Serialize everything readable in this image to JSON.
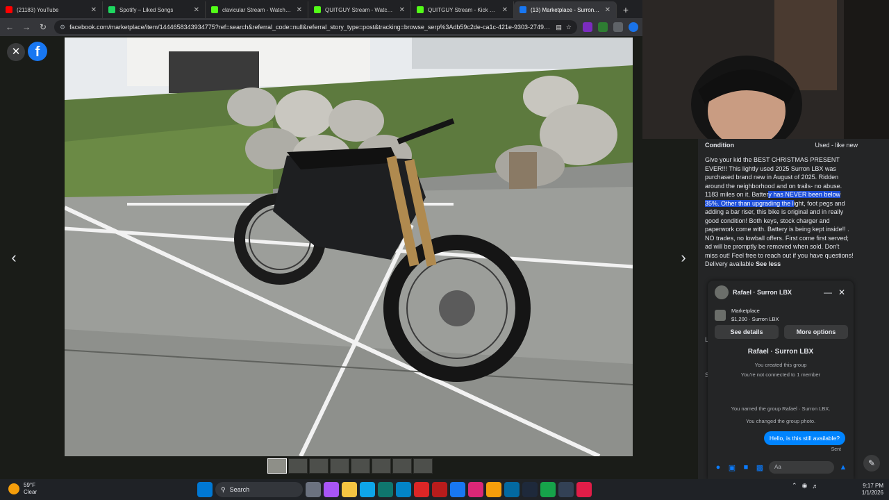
{
  "browser": {
    "tabs": [
      {
        "title": "(21183) YouTube",
        "color": "#ff0000",
        "active": false
      },
      {
        "title": "Spotify – Liked Songs",
        "color": "#1ed760",
        "active": false
      },
      {
        "title": "clavicular Stream - Watch Live o",
        "color": "#53fc18",
        "active": false
      },
      {
        "title": "QUITGUY Stream - Watch Live o",
        "color": "#53fc18",
        "active": false
      },
      {
        "title": "QUITGUY Stream - Kick Dashbo",
        "color": "#53fc18",
        "active": false
      },
      {
        "title": "(13) Marketplace - Surron LBX",
        "color": "#1877f2",
        "active": true
      }
    ],
    "url": "facebook.com/marketplace/item/1444658343934775?ref=search&referral_code=null&referral_story_type=post&tracking=browse_serp%3Adb59c2de-ca1c-421e-9303-274969d..."
  },
  "listing": {
    "condition_label": "Condition",
    "condition_value": "Used - like new",
    "description_before": "Give your kid the BEST CHRISTMAS PRESENT EVER!!! This lightly used 2025 Surron LBX was purchased brand new in August of 2025. Ridden around the neighborhood and on trails- no abuse. 1183 miles on it. Batter",
    "description_highlight": "y has NEVER been below 35%. Other than upgrading the l",
    "description_after": "ight, foot pegs and adding a bar riser, this bike is original and in really good condition! Both keys, stock charger and paperwork come with. Battery is being kept inside!! . NO trades, no lowball offers. First come first served; ad will be promptly be removed when sold. Don't miss out! Feel free to reach out if you have questions!",
    "delivery": "Delivery available",
    "see_less": "See less",
    "peek_lo": "Lo",
    "peek_se": "Se"
  },
  "chat": {
    "title": "Rafael · Surron LBX",
    "marketplace_label": "Marketplace",
    "price_item": "$1,200 · Surron LBX",
    "see_details": "See details",
    "more_options": "More options",
    "group_title": "Rafael · Surron LBX",
    "created": "You created this group",
    "not_connected": "You're not connected to 1 member",
    "named": "You named the group Rafael · Surron LBX.",
    "changed_photo": "You changed the group photo.",
    "message": "Hello, is this still available?",
    "sent": "Sent",
    "input_placeholder": "Aa"
  },
  "taskbar": {
    "temperature": "59°F",
    "condition": "Clear",
    "search": "Search",
    "time": "9:17 PM",
    "date": "1/1/2026"
  }
}
